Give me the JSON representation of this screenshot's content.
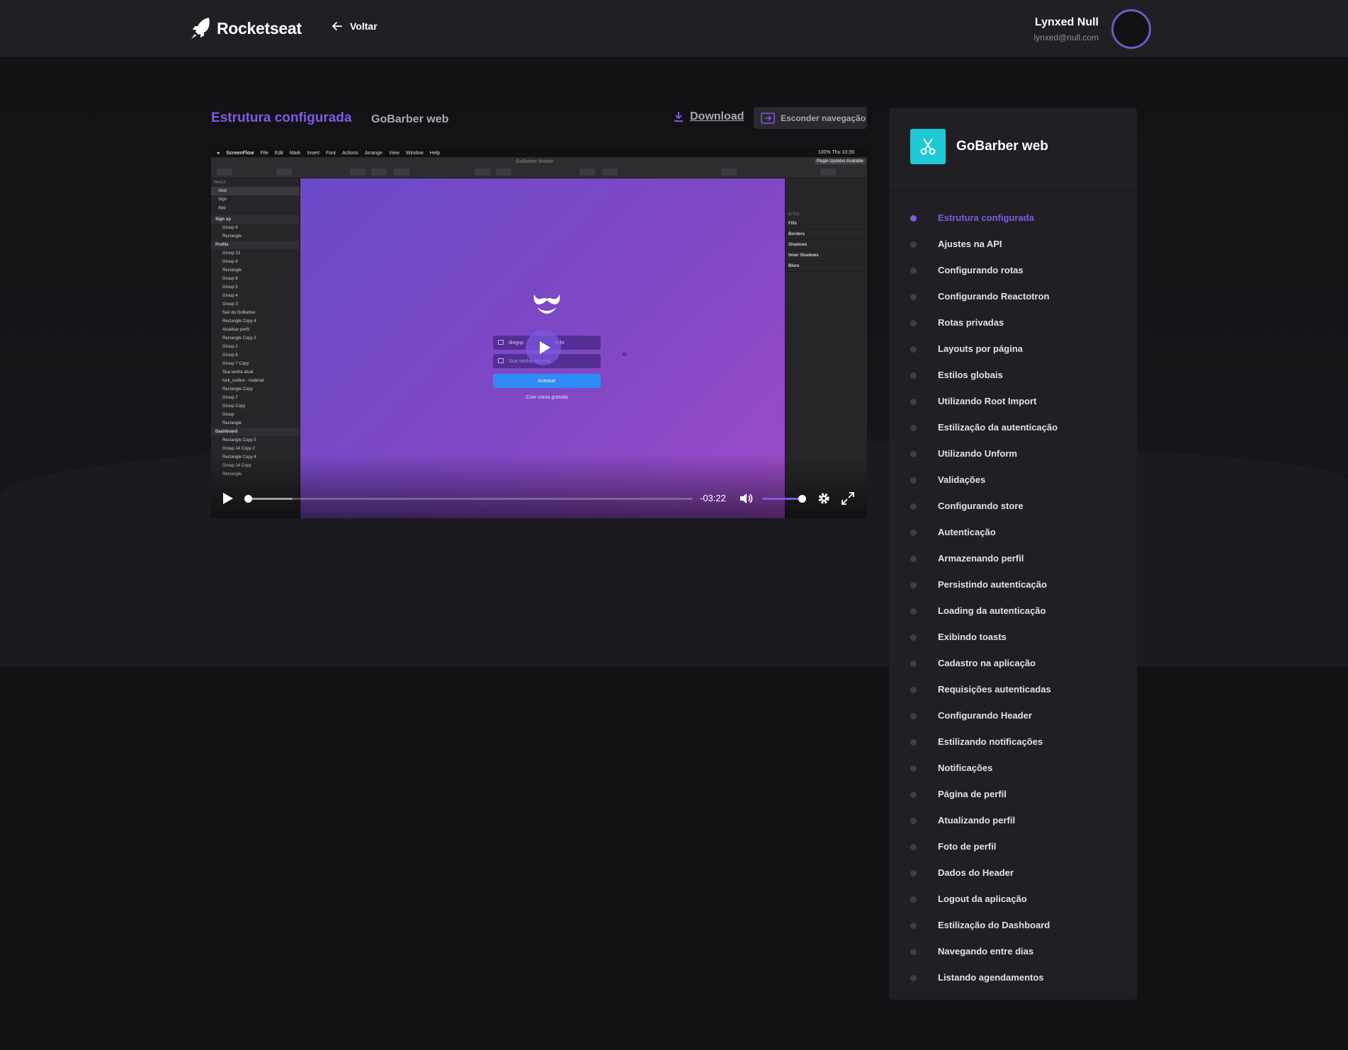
{
  "header": {
    "brand": "Rocketseat",
    "back_label": "Voltar",
    "user": {
      "name": "Lynxed Null",
      "email": "lynxed@null.com"
    }
  },
  "lesson": {
    "title": "Estrutura configurada",
    "course": "GoBarber web",
    "download_label": "Download",
    "hide_nav_label": "Esconder navegação"
  },
  "player": {
    "time_remaining": "-03:22",
    "progress_fraction": 0.0,
    "buffered_fraction": 0.1,
    "volume_fraction": 0.9,
    "screen": {
      "app": "ScreenFlow",
      "menus": [
        "File",
        "Edit",
        "Mark",
        "Insert",
        "Font",
        "Actions",
        "Arrange",
        "View",
        "Window",
        "Help"
      ],
      "status": "100%",
      "clock": "Thu 10:39",
      "file_name": "GoBarber Mobile",
      "update_notice": "Plugin Updates Available",
      "pages_label": "PAGES",
      "pages": [
        "Web",
        "Sign",
        "App"
      ],
      "layers": [
        {
          "label": "Sign up",
          "type": "section"
        },
        {
          "label": "Group 6",
          "type": "row"
        },
        {
          "label": "Rectangle",
          "type": "row"
        },
        {
          "label": "Profile",
          "type": "section"
        },
        {
          "label": "Group 13",
          "type": "row"
        },
        {
          "label": "Group 9",
          "type": "row"
        },
        {
          "label": "Rectangle",
          "type": "row"
        },
        {
          "label": "Group 6",
          "type": "row"
        },
        {
          "label": "Group 5",
          "type": "row"
        },
        {
          "label": "Group 4",
          "type": "row"
        },
        {
          "label": "Group 3",
          "type": "row"
        },
        {
          "label": "Sair do GoBarber",
          "type": "row"
        },
        {
          "label": "Rectangle Copy 4",
          "type": "row"
        },
        {
          "label": "Atualizar perfil",
          "type": "row"
        },
        {
          "label": "Rectangle Copy 2",
          "type": "row"
        },
        {
          "label": "Group 2",
          "type": "row"
        },
        {
          "label": "Group 8",
          "type": "row"
        },
        {
          "label": "Group 7 Copy",
          "type": "row"
        },
        {
          "label": "Sua senha atual",
          "type": "row"
        },
        {
          "label": "lock_outline - material",
          "type": "row"
        },
        {
          "label": "Rectangle Copy",
          "type": "row"
        },
        {
          "label": "Group 7",
          "type": "row"
        },
        {
          "label": "Group Copy",
          "type": "row"
        },
        {
          "label": "Group",
          "type": "row"
        },
        {
          "label": "Rectangle",
          "type": "row"
        },
        {
          "label": "Dashboard",
          "type": "section"
        },
        {
          "label": "Rectangle Copy 5",
          "type": "row"
        },
        {
          "label": "Group 14 Copy 2",
          "type": "row"
        },
        {
          "label": "Rectangle Copy 4",
          "type": "row"
        },
        {
          "label": "Group 14 Copy",
          "type": "row"
        },
        {
          "label": "Rectangle",
          "type": "row"
        }
      ],
      "inspector": {
        "style_label": "STYLE",
        "rows": [
          "Fills",
          "Borders",
          "Shadows",
          "Inner Shadows",
          "Blurs"
        ]
      },
      "mock_form": {
        "email": "diegop",
        "email_tail": "m.br",
        "password_placeholder": "Sua senha secreta",
        "submit_label": "Acessar",
        "signup_link": "Criar conta gratuita"
      }
    }
  },
  "sidebar": {
    "course_name": "GoBarber web",
    "lessons": [
      "Estrutura configurada",
      "Ajustes na API",
      "Configurando rotas",
      "Configurando Reactotron",
      "Rotas privadas",
      "Layouts por página",
      "Estilos globais",
      "Utilizando Root Import",
      "Estilização da autenticação",
      "Utilizando Unform",
      "Validações",
      "Configurando store",
      "Autenticação",
      "Armazenando perfil",
      "Persistindo autenticação",
      "Loading da autenticação",
      "Exibindo toasts",
      "Cadastro na aplicação",
      "Requisições autenticadas",
      "Configurando Header",
      "Estilizando notificações",
      "Notificações",
      "Página de perfil",
      "Atualizando perfil",
      "Foto de perfil",
      "Dados do Header",
      "Logout da aplicação",
      "Estilização do Dashboard",
      "Navegando entre dias",
      "Listando agendamentos"
    ],
    "active_index": 0
  },
  "colors": {
    "accent": "#8257e5",
    "course_icon": "#1fcad6",
    "background": "#121214",
    "surface": "#202024"
  }
}
